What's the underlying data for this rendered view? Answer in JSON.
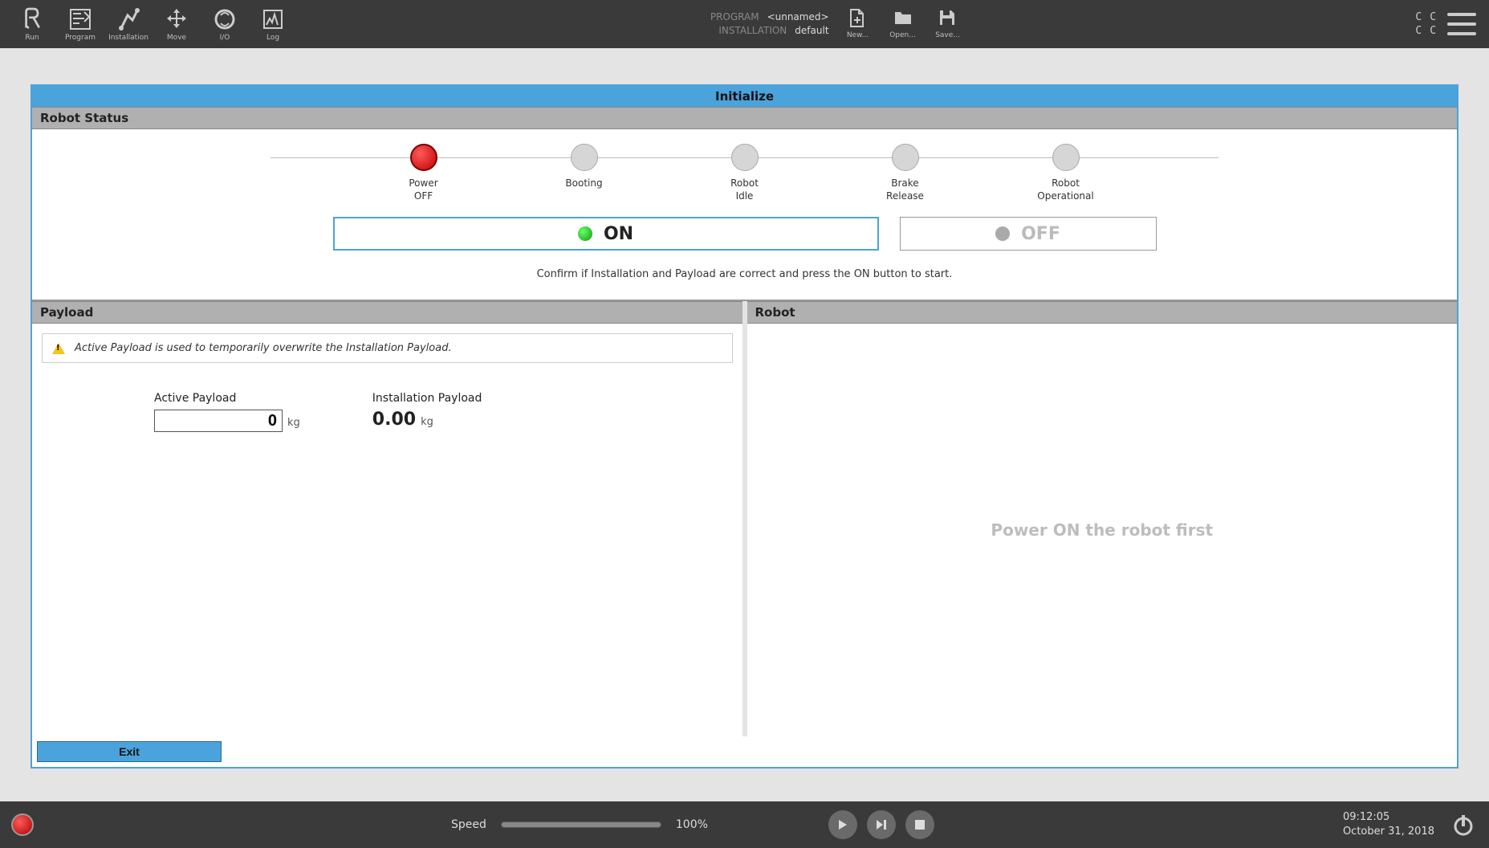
{
  "topbar": {
    "items": [
      {
        "label": "Run"
      },
      {
        "label": "Program"
      },
      {
        "label": "Installation"
      },
      {
        "label": "Move"
      },
      {
        "label": "I/O"
      },
      {
        "label": "Log"
      }
    ],
    "program_key": "PROGRAM",
    "program_val": "<unnamed>",
    "install_key": "INSTALLATION",
    "install_val": "default",
    "file_btns": [
      {
        "label": "New..."
      },
      {
        "label": "Open..."
      },
      {
        "label": "Save..."
      }
    ],
    "cc": [
      "C",
      "C",
      "C",
      "C"
    ]
  },
  "main": {
    "title": "Initialize",
    "status_hdr": "Robot Status",
    "stages": [
      {
        "l1": "Power",
        "l2": "OFF"
      },
      {
        "l1": "Booting",
        "l2": ""
      },
      {
        "l1": "Robot",
        "l2": "Idle"
      },
      {
        "l1": "Brake",
        "l2": "Release"
      },
      {
        "l1": "Robot",
        "l2": "Operational"
      }
    ],
    "on_label": "ON",
    "off_label": "OFF",
    "confirm": "Confirm if Installation and Payload are correct and press the ON button to start.",
    "payload_hdr": "Payload",
    "robot_hdr": "Robot",
    "warn": "Active Payload is used to temporarily overwrite the Installation Payload.",
    "active_payload_label": "Active Payload",
    "active_payload_value": "0",
    "install_payload_label": "Installation Payload",
    "install_payload_value": "0.00",
    "kg": "kg",
    "robot_msg": "Power ON the robot first",
    "exit": "Exit"
  },
  "bottombar": {
    "speed_label": "Speed",
    "speed_pct": "100%",
    "time": "09:12:05",
    "date": "October 31, 2018"
  }
}
